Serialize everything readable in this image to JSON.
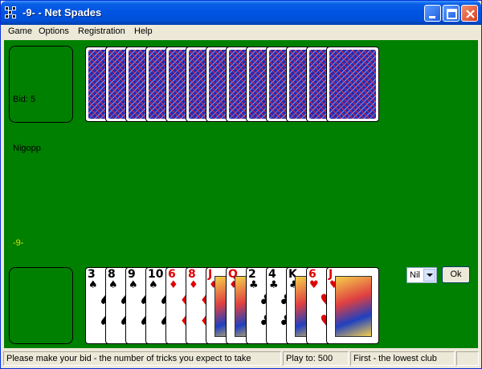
{
  "window": {
    "title": "-9- - Net Spades"
  },
  "menu": [
    "Game",
    "Options",
    "Registration",
    "Help"
  ],
  "north": {
    "bid_label": "Bid: 5",
    "card_backs": 13
  },
  "players": {
    "opponent_name": "Nigopp",
    "self_name": "-9-"
  },
  "hand": [
    {
      "rank": "3",
      "suit": "♠",
      "color": "#000000"
    },
    {
      "rank": "8",
      "suit": "♠",
      "color": "#000000"
    },
    {
      "rank": "9",
      "suit": "♠",
      "color": "#000000"
    },
    {
      "rank": "10",
      "suit": "♠",
      "color": "#000000"
    },
    {
      "rank": "6",
      "suit": "♦",
      "color": "#e00000"
    },
    {
      "rank": "8",
      "suit": "♦",
      "color": "#e00000"
    },
    {
      "rank": "J",
      "suit": "♦",
      "color": "#e00000"
    },
    {
      "rank": "Q",
      "suit": "♦",
      "color": "#e00000"
    },
    {
      "rank": "2",
      "suit": "♣",
      "color": "#000000"
    },
    {
      "rank": "4",
      "suit": "♣",
      "color": "#000000"
    },
    {
      "rank": "K",
      "suit": "♣",
      "color": "#000000"
    },
    {
      "rank": "6",
      "suit": "♥",
      "color": "#e00000"
    },
    {
      "rank": "J",
      "suit": "♥",
      "color": "#e00000"
    }
  ],
  "bid_control": {
    "selected": "Nil",
    "ok_label": "Ok"
  },
  "status": {
    "message": "Please make your bid - the number of tricks you expect to take",
    "play_to": "Play to: 500",
    "first": "First - the lowest club"
  },
  "colors": {
    "felt": "#008000",
    "titlebar": "#0054e3"
  }
}
